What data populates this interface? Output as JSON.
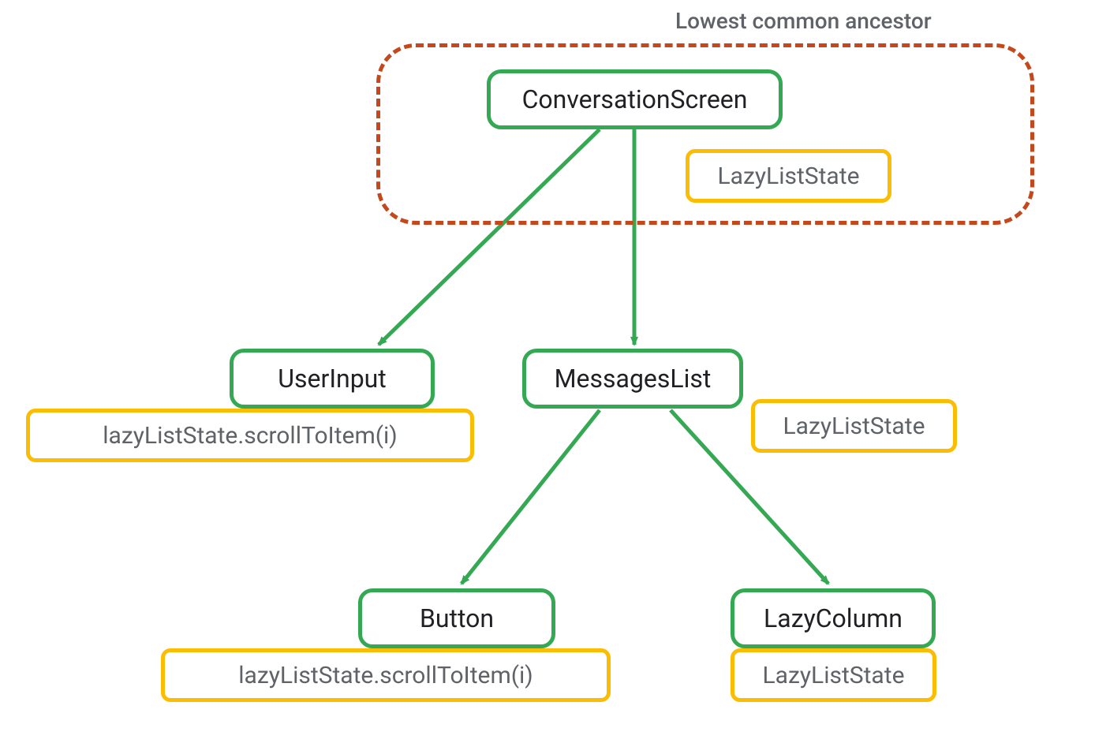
{
  "diagram": {
    "caption": "Lowest common ancestor",
    "nodes": {
      "conversationScreen": "ConversationScreen",
      "userInput": "UserInput",
      "messagesList": "MessagesList",
      "button": "Button",
      "lazyColumn": "LazyColumn"
    },
    "annotations": {
      "lazyListStateTop": "LazyListState",
      "userInputDetail": "lazyListState.scrollToItem(i)",
      "messagesListDetail": "LazyListState",
      "buttonDetail": "lazyListState.scrollToItem(i)",
      "lazyColumnDetail": "LazyListState"
    },
    "colors": {
      "green": "#34a853",
      "yellow": "#fbbc04",
      "dashRed": "#c5471c",
      "textDark": "#202124",
      "textGray": "#5f6368"
    }
  }
}
